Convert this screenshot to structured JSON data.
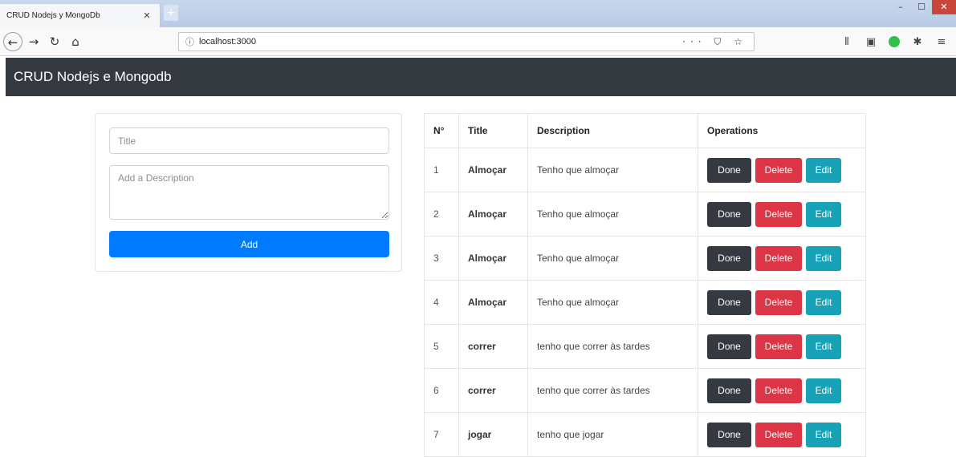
{
  "browser": {
    "tab_title": "CRUD Nodejs y MongoDb",
    "tab_close": "✕",
    "new_tab": "+",
    "url": "localhost:3000",
    "url_info_icon": "info-icon",
    "url_actions": "··· ⛉ ☆",
    "toolbar_icons": [
      "library-icon",
      "sidebar-icon",
      "extension-green-icon",
      "extension-icon",
      "menu-icon"
    ]
  },
  "app": {
    "brand": "CRUD Nodejs e Mongodb"
  },
  "form": {
    "title_placeholder": "Title",
    "description_placeholder": "Add a Description",
    "add_label": "Add"
  },
  "table": {
    "headers": [
      "N°",
      "Title",
      "Description",
      "Operations"
    ],
    "rows": [
      {
        "n": "1",
        "title": "Almoçar",
        "description": "Tenho que almoçar"
      },
      {
        "n": "2",
        "title": "Almoçar",
        "description": "Tenho que almoçar"
      },
      {
        "n": "3",
        "title": "Almoçar",
        "description": "Tenho que almoçar"
      },
      {
        "n": "4",
        "title": "Almoçar",
        "description": "Tenho que almoçar"
      },
      {
        "n": "5",
        "title": "correr",
        "description": "tenho que correr às tardes"
      },
      {
        "n": "6",
        "title": "correr",
        "description": "tenho que correr às tardes"
      },
      {
        "n": "7",
        "title": "jogar",
        "description": "tenho que jogar"
      }
    ],
    "done_label": "Done",
    "delete_label": "Delete",
    "edit_label": "Edit"
  },
  "colors": {
    "navbar": "#343a40",
    "primary": "#007bff",
    "danger": "#dc3545",
    "info": "#17a2b8",
    "dark": "#343a40"
  }
}
